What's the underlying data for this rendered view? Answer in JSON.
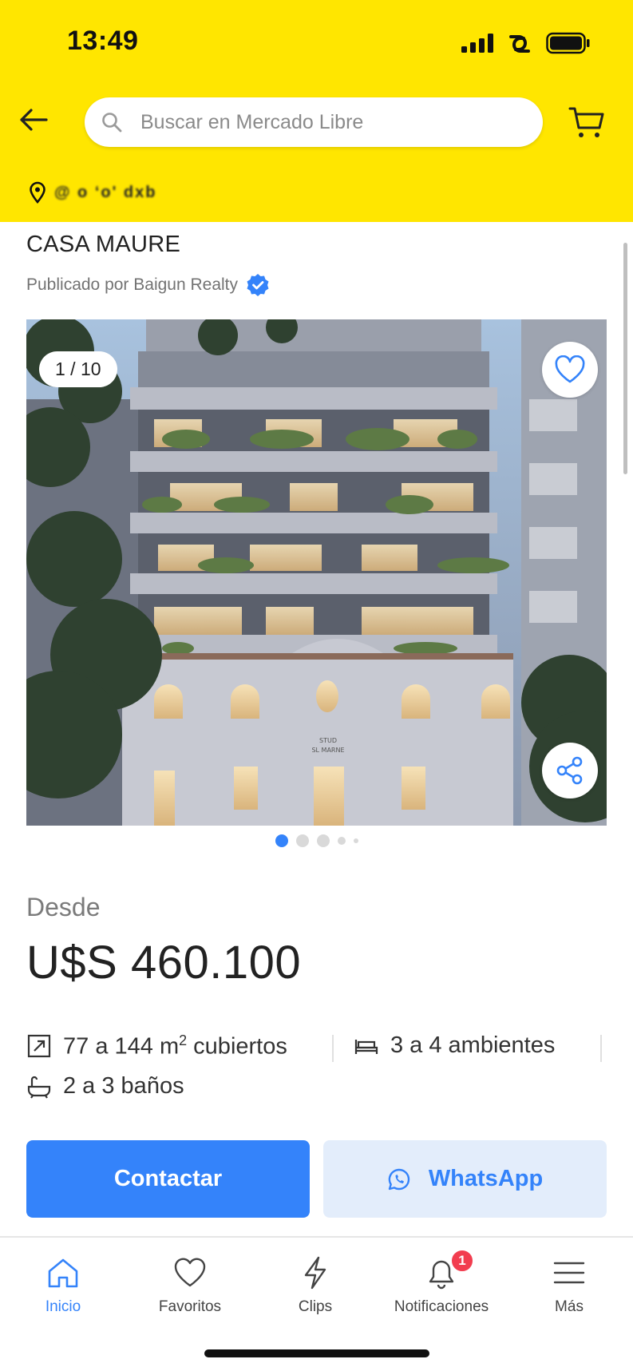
{
  "status_bar": {
    "time": "13:49"
  },
  "header": {
    "search_placeholder": "Buscar en Mercado Libre",
    "location_text": "@ o ‘o' dxb"
  },
  "listing": {
    "title": "CASA MAURE",
    "publisher": "Publicado por Baigun Realty",
    "gallery": {
      "counter": "1 / 10",
      "sign_text": "STUD\nSL MARNE",
      "total_images": 10,
      "current_image": 1
    },
    "price_prefix": "Desde",
    "price": "U$S 460.100",
    "features": {
      "area_prefix": "77 a 144 m",
      "area_sup": "2",
      "area_suffix": " cubiertos",
      "rooms": "3 a 4 ambientes",
      "baths": "2 a 3 baños"
    },
    "contact_label": "Contactar",
    "whatsapp_label": "WhatsApp"
  },
  "bottom_nav": {
    "items": [
      {
        "label": "Inicio",
        "icon": "home-icon",
        "active": true
      },
      {
        "label": "Favoritos",
        "icon": "heart-icon",
        "active": false
      },
      {
        "label": "Clips",
        "icon": "bolt-icon",
        "active": false
      },
      {
        "label": "Notificaciones",
        "icon": "bell-icon",
        "active": false,
        "badge": "1"
      },
      {
        "label": "Más",
        "icon": "menu-icon",
        "active": false
      }
    ]
  },
  "colors": {
    "header_yellow": "#ffe600",
    "primary_blue": "#3483fa",
    "whatsapp_bg": "#e3edfb",
    "badge_red": "#f23d4f"
  }
}
